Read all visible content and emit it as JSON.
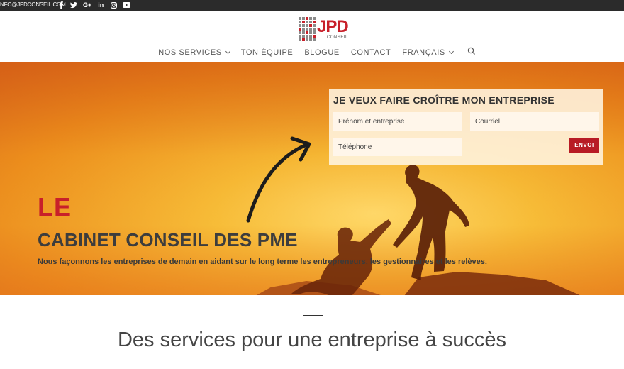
{
  "topbar": {
    "email": "NFO@JPDCONSEIL.COM",
    "socials": [
      "facebook-icon",
      "twitter-icon",
      "google-plus-icon",
      "linkedin-icon",
      "instagram-icon",
      "youtube-icon"
    ],
    "google_plus_label": "G+",
    "linkedin_label": "in"
  },
  "logo": {
    "text": "JPD",
    "sub": "CONSEIL"
  },
  "nav": {
    "items": [
      {
        "label": "NOS SERVICES",
        "dropdown": true
      },
      {
        "label": "TON ÉQUIPE",
        "dropdown": false
      },
      {
        "label": "BLOGUE",
        "dropdown": false
      },
      {
        "label": "CONTACT",
        "dropdown": false
      },
      {
        "label": "FRANÇAIS",
        "dropdown": true
      }
    ],
    "search_icon": "search-icon"
  },
  "form": {
    "title": "JE VEUX FAIRE CROÎTRE MON ENTREPRISE",
    "name_placeholder": "Prénom et entreprise",
    "email_placeholder": "Courriel",
    "phone_placeholder": "Téléphone",
    "submit_label": "ENVOI"
  },
  "hero": {
    "le": "LE",
    "title": "CABINET CONSEIL DES PME",
    "subtitle": "Nous façonnons les entreprises de demain en aidant sur le long terme les entrepreneurs, les gestionnaires et les relèves."
  },
  "section": {
    "title": "Des services pour une entreprise à succès"
  },
  "colors": {
    "brand_red": "#c8202a",
    "button_red": "#b81b24",
    "topbar": "#2b2b2b"
  }
}
